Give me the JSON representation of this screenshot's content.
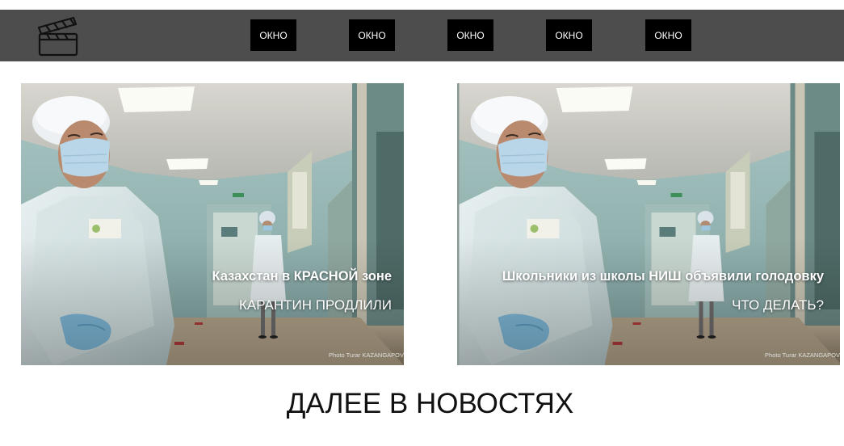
{
  "nav": {
    "items": [
      {
        "label": "ОКНО"
      },
      {
        "label": "ОКНО"
      },
      {
        "label": "ОКНО"
      },
      {
        "label": "ОКНО"
      },
      {
        "label": "ОКНО"
      }
    ],
    "logo_icon": "clapperboard-icon"
  },
  "cards": [
    {
      "headline": "Казахстан в КРАСНОЙ зоне",
      "subline": "КАРАНТИН ПРОДЛИЛИ",
      "credit": "Photo Turar KAZANGAPOV"
    },
    {
      "headline": "Школьники из школы НИШ объявили голодовку",
      "subline": "ЧТО ДЕЛАТЬ?",
      "credit": "Photo Turar KAZANGAPOV"
    }
  ],
  "section": {
    "title": "ДАЛЕЕ В НОВОСТЯХ"
  },
  "colors": {
    "navbar": "#4d4d4d",
    "nav_button": "#000000",
    "text_on_photo": "#ffffff"
  }
}
